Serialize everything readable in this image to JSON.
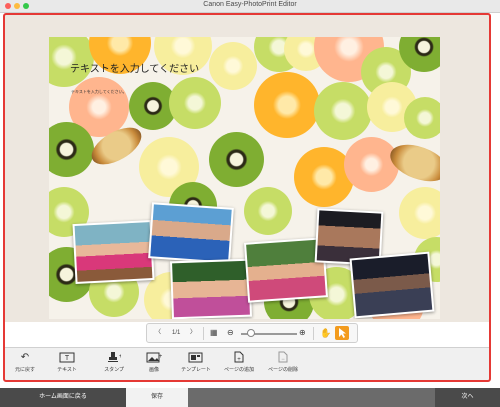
{
  "window": {
    "title": "Canon Easy-PhotoPrint Editor"
  },
  "canvas": {
    "title_text": "テキストを入力してください",
    "sub_text": "テキストを入力してください。"
  },
  "pager": {
    "page_label": "1/1"
  },
  "toolbar": {
    "undo": "元に戻す",
    "text": "テキスト",
    "stamp": "スタンプ",
    "image": "画像",
    "template": "テンプレート",
    "add_page": "ページの追加",
    "delete_page": "ページの削除"
  },
  "footer": {
    "home": "ホーム画面に戻る",
    "save": "保存",
    "next": "次へ"
  }
}
